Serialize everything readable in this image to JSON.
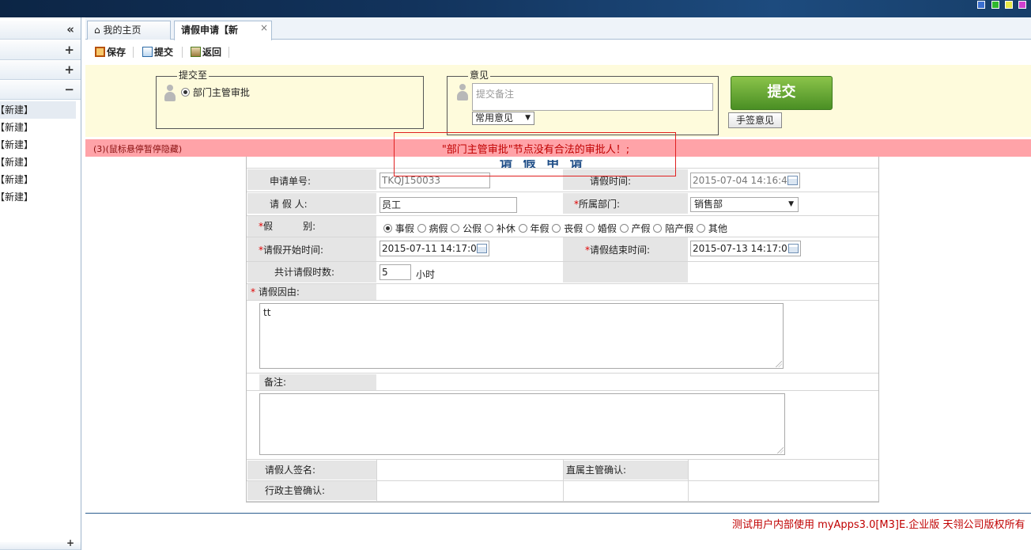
{
  "window": {
    "colors": {
      "green": "#2eb82e",
      "yellow": "#e8e84a",
      "magenta": "#d040d0",
      "blue": "#3b6fd0"
    }
  },
  "sidebar": {
    "collapse_glyph": "«",
    "sections": [
      {
        "sign": "+"
      },
      {
        "sign": "+"
      },
      {
        "sign": "−"
      }
    ],
    "items": [
      "【新建】",
      "【新建】",
      "【新建】",
      "【新建】",
      "【新建】",
      "【新建】"
    ],
    "bottom_sign": "+"
  },
  "tabs": [
    {
      "label": "我的主页",
      "icon": "home-icon"
    },
    {
      "label": "请假申请【新",
      "close": "×"
    }
  ],
  "toolbar": {
    "save": "保存",
    "submit": "提交",
    "back": "返回",
    "separators": [
      "|",
      "|",
      "|"
    ]
  },
  "submit_panel": {
    "submit_to_legend": "提交至",
    "submit_to_option": "部门主管审批",
    "opinion_legend": "意见",
    "opinion_placeholder": "提交备注",
    "common_opinion": "常用意见",
    "submit_button": "提交",
    "handwrite_button": "手签意见"
  },
  "error": {
    "hint": "(3)(鼠标悬停暂停隐藏)",
    "message": "\"部门主管审批\"节点没有合法的审批人！;"
  },
  "form": {
    "title_partial": "请 假 申 请",
    "request_no_label": "申请单号:",
    "request_no": "TKQJ150033",
    "request_time_label": "请假时间:",
    "request_time": "2015-07-04 14:16:44",
    "applicant_label": "请 假 人:",
    "applicant": "员工",
    "dept_label": "所属部门:",
    "dept": "销售部",
    "leave_type_label": "假          别:",
    "leave_types": [
      "事假",
      "病假",
      "公假",
      "补休",
      "年假",
      "丧假",
      "婚假",
      "产假",
      "陪产假",
      "其他"
    ],
    "leave_type_selected": 0,
    "start_label": "请假开始时间:",
    "start": "2015-07-11 14:17:03",
    "end_label": "请假结束时间:",
    "end": "2015-07-13 14:17:07",
    "hours_label": "共计请假时数:",
    "hours": "5",
    "hours_unit": "小时",
    "reason_label": "请假因由:",
    "reason": "tt",
    "remark_label": "备注:",
    "remark": "",
    "sign_label": "请假人签名:",
    "supervisor_label": "直属主管确认:",
    "admin_label": "行政主管确认:"
  },
  "footer": "测试用户内部使用 myApps3.0[M3]E.企业版 天翎公司版权所有"
}
